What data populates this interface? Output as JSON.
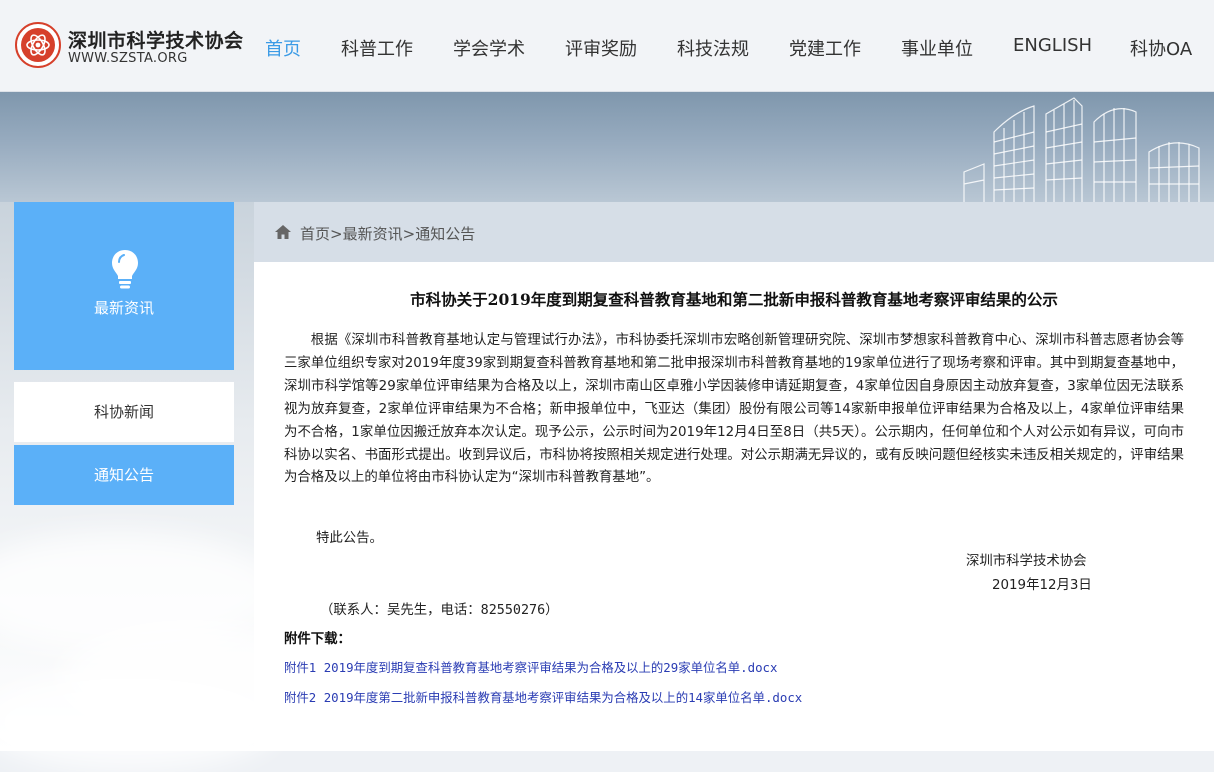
{
  "site": {
    "name": "深圳市科学技术协会",
    "url": "WWW.SZSTA.ORG"
  },
  "nav": {
    "items": [
      {
        "label": "首页",
        "active": true
      },
      {
        "label": "科普工作"
      },
      {
        "label": "学会学术"
      },
      {
        "label": "评审奖励"
      },
      {
        "label": "科技法规"
      },
      {
        "label": "党建工作"
      },
      {
        "label": "事业单位"
      },
      {
        "label": "ENGLISH"
      },
      {
        "label": "科协OA"
      }
    ]
  },
  "sidebar": {
    "hero_title": "最新资讯",
    "hero_icon": "lightbulb-icon",
    "items": [
      {
        "label": "科协新闻"
      },
      {
        "label": "通知公告",
        "active": true
      }
    ]
  },
  "breadcrumb": {
    "home": "首页",
    "sep": ">",
    "level1": "最新资讯",
    "level2": "通知公告"
  },
  "article": {
    "title": "市科协关于2019年度到期复查科普教育基地和第二批新申报科普教育基地考察评审结果的公示",
    "body": "根据《深圳市科普教育基地认定与管理试行办法》，市科协委托深圳市宏略创新管理研究院、深圳市梦想家科普教育中心、深圳市科普志愿者协会等三家单位组织专家对2019年度39家到期复查科普教育基地和第二批申报深圳市科普教育基地的19家单位进行了现场考察和评审。其中到期复查基地中，深圳市科学馆等29家单位评审结果为合格及以上，深圳市南山区卓雅小学因装修申请延期复查，4家单位因自身原因主动放弃复查，3家单位因无法联系视为放弃复查，2家单位评审结果为不合格；新申报单位中，飞亚达（集团）股份有限公司等14家新申报单位评审结果为合格及以上，4家单位评审结果为不合格，1家单位因搬迁放弃本次认定。现予公示，公示时间为2019年12月4日至8日（共5天）。公示期内，任何单位和个人对公示如有异议，可向市科协以实名、书面形式提出。收到异议后，市科协将按照相关规定进行处理。对公示期满无异议的，或有反映问题但经核实未违反相关规定的，评审结果为合格及以上的单位将由市科协认定为“深圳市科普教育基地”。",
    "closing": "特此公告。",
    "signature_org": "深圳市科学技术协会",
    "signature_date": "2019年12月3日",
    "contact": "（联系人：吴先生，电话：82550276）",
    "attachments_label": "附件下载：",
    "attachments": [
      {
        "label": "附件1 2019年度到期复查科普教育基地考察评审结果为合格及以上的29家单位名单.docx"
      },
      {
        "label": "附件2 2019年度第二批新申报科普教育基地考察评审结果为合格及以上的14家单位名单.docx"
      }
    ]
  },
  "colors": {
    "accent": "#5bb0f8",
    "nav_active": "#3b9be6",
    "logo_red": "#d6402b",
    "link": "#2a3cb3",
    "crumb_bar": "#d6dee7"
  }
}
